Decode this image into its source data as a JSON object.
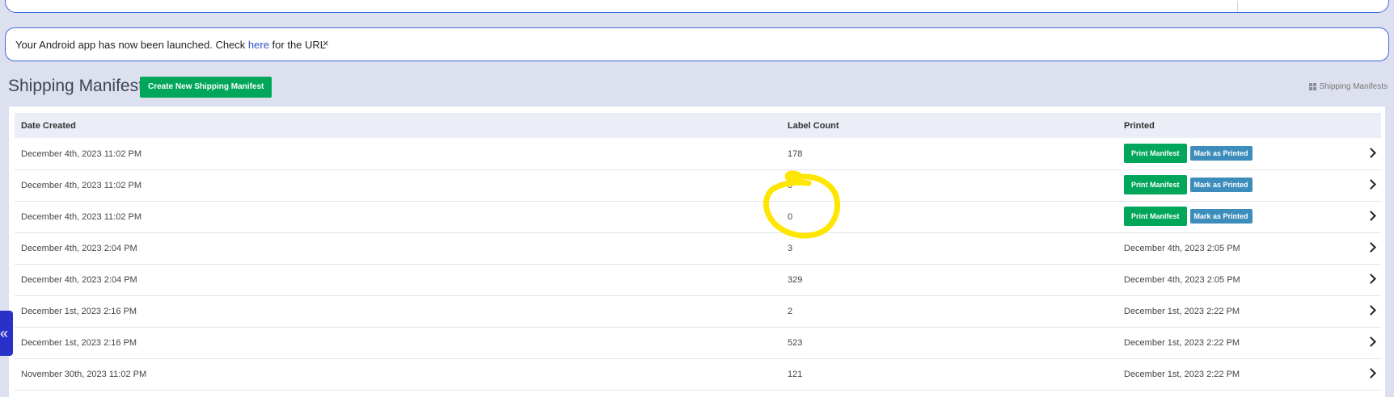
{
  "alert": {
    "message_prefix": "Your Android app has now been launched. Check ",
    "link_text": "here",
    "message_suffix": " for the URL",
    "close_label": "×"
  },
  "page": {
    "title": "Shipping Manifests",
    "create_button": "Create New Shipping Manifest",
    "breadcrumb": "Shipping Manifests",
    "breadcrumb_icon": "grid-icon"
  },
  "table": {
    "headers": [
      "Date Created",
      "Label Count",
      "Printed"
    ],
    "print_label": "Print Manifest",
    "mark_label": "Mark as Printed",
    "rows": [
      {
        "date": "December 4th, 2023 11:02 PM",
        "count": "178",
        "printed": ""
      },
      {
        "date": "December 4th, 2023 11:02 PM",
        "count": "0",
        "printed": ""
      },
      {
        "date": "December 4th, 2023 11:02 PM",
        "count": "0",
        "printed": ""
      },
      {
        "date": "December 4th, 2023 2:04 PM",
        "count": "3",
        "printed": "December 4th, 2023 2:05 PM"
      },
      {
        "date": "December 4th, 2023 2:04 PM",
        "count": "329",
        "printed": "December 4th, 2023 2:05 PM"
      },
      {
        "date": "December 1st, 2023 2:16 PM",
        "count": "2",
        "printed": "December 1st, 2023 2:22 PM"
      },
      {
        "date": "December 1st, 2023 2:16 PM",
        "count": "523",
        "printed": "December 1st, 2023 2:22 PM"
      },
      {
        "date": "November 30th, 2023 11:02 PM",
        "count": "121",
        "printed": "December 1st, 2023 2:22 PM"
      }
    ]
  },
  "sidebar_toggle": {
    "label": "«",
    "icon": "double-chevron-left-icon"
  },
  "annotation": {
    "color": "#ffe600"
  }
}
